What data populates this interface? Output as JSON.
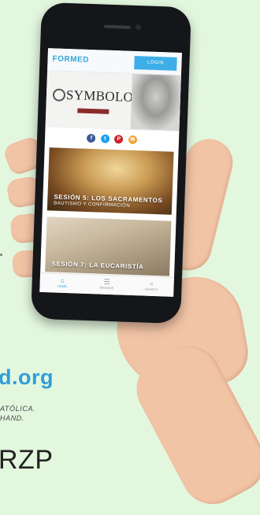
{
  "background": {
    "site_text": "d.org",
    "tagline_line1": "ATÓLICA.",
    "tagline_line2": "HAND.",
    "code_text": "RZP",
    "colors": {
      "bg": "#e3f7df",
      "site": "#2f9ed8"
    }
  },
  "phone_app": {
    "header": {
      "logo": "FORMED",
      "login_label": "LOGIN"
    },
    "hero": {
      "title": "SYMBOLON"
    },
    "social": {
      "icons": [
        "facebook-icon",
        "twitter-icon",
        "pinterest-icon",
        "email-icon"
      ],
      "glyphs": [
        "f",
        "t",
        "P",
        "✉"
      ],
      "colors": [
        "#3b5998",
        "#1da1f2",
        "#cb2027",
        "#f0a63a"
      ]
    },
    "cards": [
      {
        "title": "SESIÓN 5: LOS SACRAMENTOS",
        "subtitle": "BAUTISMO Y CONFIRMACIÓN"
      },
      {
        "title": "SESIÓN 7: LA EUCARISTÍA",
        "subtitle": ""
      }
    ],
    "tabbar": {
      "tabs": [
        {
          "label": "HOME",
          "icon": "home-icon",
          "glyph": "⌂"
        },
        {
          "label": "BROWSE",
          "icon": "menu-icon",
          "glyph": "☰"
        },
        {
          "label": "SEARCH",
          "icon": "search-icon",
          "glyph": "⌕"
        }
      ]
    },
    "colors": {
      "accent": "#2fa7de"
    }
  }
}
